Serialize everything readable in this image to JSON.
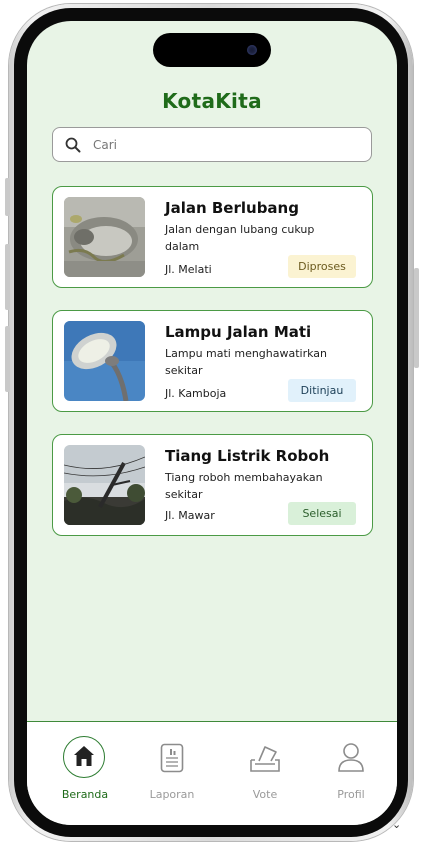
{
  "app": {
    "title": "KotaKita"
  },
  "search": {
    "placeholder": "Cari"
  },
  "reports": [
    {
      "title": "Jalan Berlubang",
      "description": "Jalan dengan lubang cukup dalam",
      "location": "Jl. Melati",
      "status": "Diproses",
      "status_bg": "#fbf3d2",
      "status_color": "#6b5a1e",
      "image": "pothole-photo"
    },
    {
      "title": "Lampu Jalan Mati",
      "description": "Lampu mati menghawatirkan sekitar",
      "location": "Jl. Kamboja",
      "status": "Ditinjau",
      "status_bg": "#e1f1fb",
      "status_color": "#20425a",
      "image": "street-lamp-photo"
    },
    {
      "title": "Tiang Listrik Roboh",
      "description": "Tiang roboh membahayakan sekitar",
      "location": "Jl. Mawar",
      "status": "Selesai",
      "status_bg": "#d9f0d9",
      "status_color": "#2c5e2c",
      "image": "fallen-pole-photo"
    }
  ],
  "nav": [
    {
      "label": "Beranda",
      "icon": "home-icon",
      "active": true
    },
    {
      "label": "Laporan",
      "icon": "report-icon",
      "active": false
    },
    {
      "label": "Vote",
      "icon": "vote-icon",
      "active": false
    },
    {
      "label": "Profil",
      "icon": "profile-icon",
      "active": false
    }
  ],
  "colors": {
    "accent": "#1f6b1a",
    "screen_bg": "#e8f4e6",
    "card_border": "#4b9a45"
  }
}
